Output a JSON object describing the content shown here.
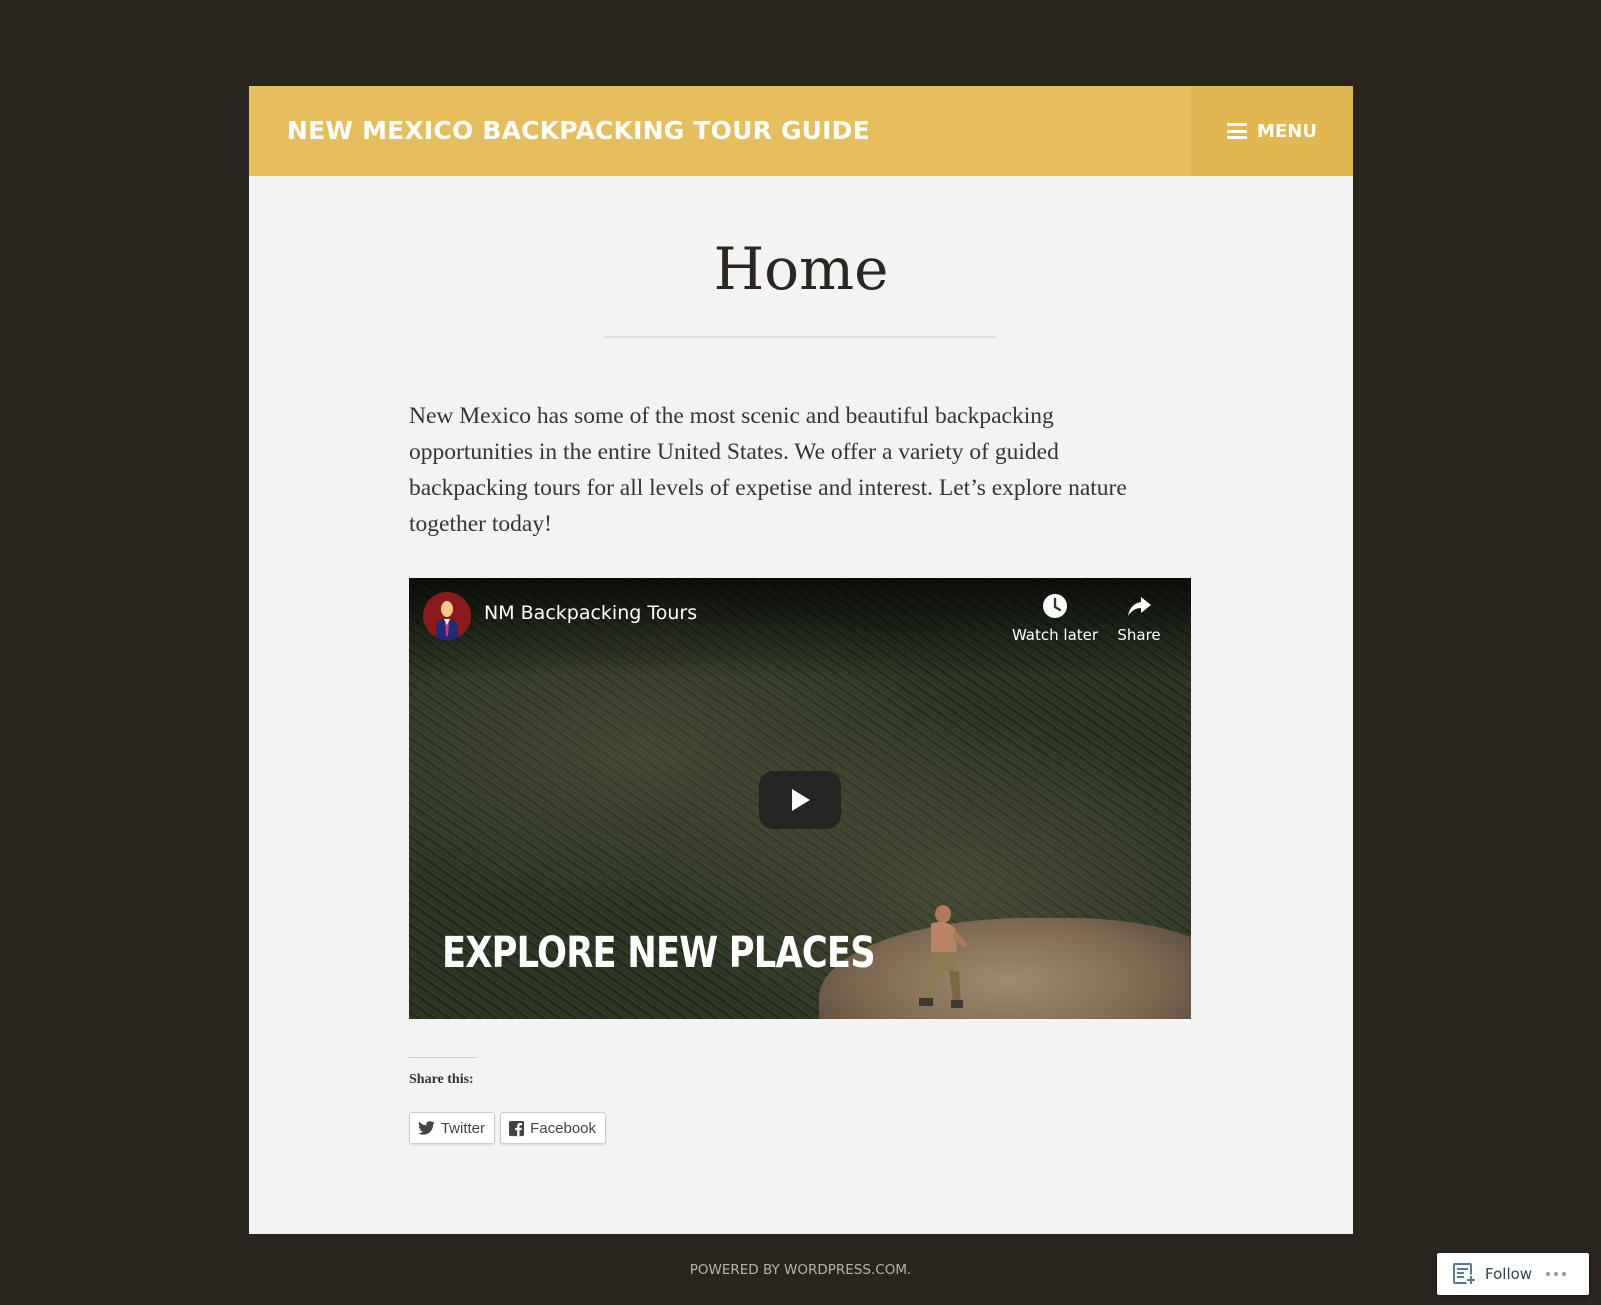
{
  "header": {
    "site_title": "NEW MEXICO BACKPACKING TOUR GUIDE",
    "menu_label": "MENU"
  },
  "page": {
    "title": "Home",
    "intro": "New Mexico has some of the most scenic and beautiful backpacking opportunities in the entire United States. We offer a variety of guided backpacking tours for all levels of expetise and interest. Let’s explore nature together today!"
  },
  "video": {
    "channel_name": "NM Backpacking Tours",
    "watch_later_label": "Watch later",
    "share_label": "Share",
    "caption": "EXPLORE NEW PLACES",
    "icons": [
      "avatar",
      "clock-icon",
      "share-arrow-icon",
      "play-icon"
    ]
  },
  "sharing": {
    "heading": "Share this:",
    "buttons": [
      {
        "label": "Twitter",
        "icon": "twitter-icon"
      },
      {
        "label": "Facebook",
        "icon": "facebook-icon"
      }
    ]
  },
  "footer": {
    "credit": "POWERED BY WORDPRESS.COM."
  },
  "follow_widget": {
    "label": "Follow",
    "icons": [
      "follow-reader-icon",
      "more-icon"
    ]
  },
  "colors": {
    "background": "#2b2520",
    "header": "#e6be5d",
    "menu_button": "#e2b650",
    "content": "#f3f3f3",
    "text": "#3a342f"
  }
}
